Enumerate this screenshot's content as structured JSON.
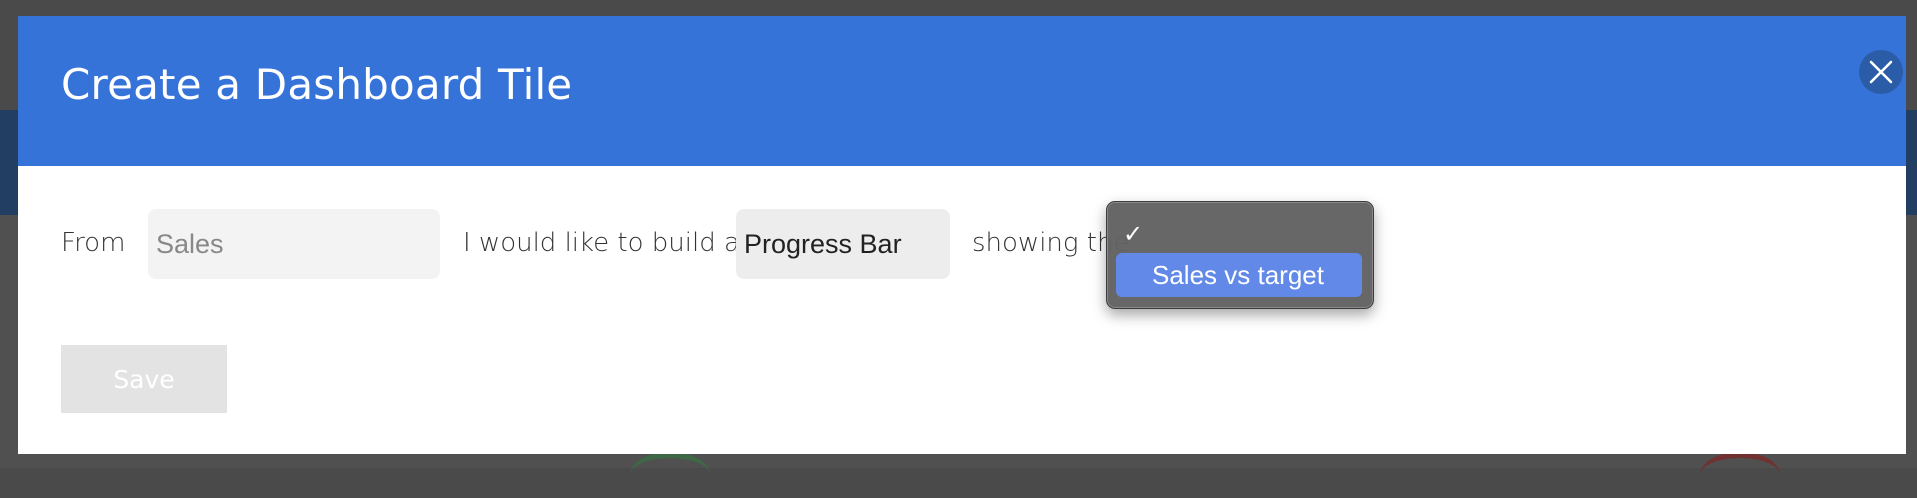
{
  "modal": {
    "title": "Create a Dashboard Tile",
    "close_icon": "close-icon",
    "header_color": "#3673d9"
  },
  "form": {
    "from_label": "From",
    "source_value": "Sales",
    "build_label": "I would like to build a",
    "tile_type_value": "Progress Bar",
    "showing_label": "showing the",
    "metric_dropdown": {
      "open": true,
      "checked_option_label": "",
      "options": [
        {
          "label": "",
          "checked": true
        },
        {
          "label": "Sales vs target",
          "highlighted": true
        }
      ],
      "check_icon": "checkmark-icon"
    },
    "save_label": "Save"
  }
}
